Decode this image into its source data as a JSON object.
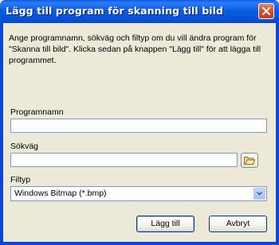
{
  "window": {
    "title": "Lägg till program för skanning till bild"
  },
  "dialog": {
    "description": "Ange programnamn, sökväg och filtyp om du vill ändra program för \"Skanna till bild\". Klicka sedan på knappen \"Lägg till\" för att lägga till programmet.",
    "program_name_label": "Programnamn",
    "program_name_value": "",
    "path_label": "Sökväg",
    "path_value": "",
    "filetype_label": "Filtyp",
    "filetype_selected": "Windows Bitmap (*.bmp)",
    "add_button": "Lägg till",
    "cancel_button": "Avbryt"
  },
  "icons": {
    "close": "close-icon",
    "browse": "folder-icon",
    "dropdown": "chevron-down-icon"
  },
  "colors": {
    "titlebar": "#0b5ddf",
    "client": "#ece9d8",
    "close": "#d8512e",
    "field_border": "#7f9db9"
  }
}
